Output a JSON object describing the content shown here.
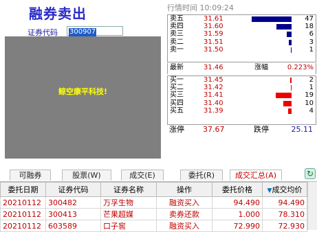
{
  "header": {
    "title": "融券卖出",
    "code_label": "证券代码",
    "code_value": "300907",
    "placeholder_message": "鲸空康平科技!"
  },
  "quote": {
    "time_label": "行情时间",
    "time_value": "10:09:24",
    "sell": [
      {
        "label": "卖五",
        "price": "31.61",
        "volume": "47",
        "vol_num": 47
      },
      {
        "label": "卖四",
        "price": "31.60",
        "volume": "18",
        "vol_num": 18
      },
      {
        "label": "卖三",
        "price": "31.59",
        "volume": "6",
        "vol_num": 6
      },
      {
        "label": "卖二",
        "price": "31.51",
        "volume": "3",
        "vol_num": 3
      },
      {
        "label": "卖一",
        "price": "31.50",
        "volume": "1",
        "vol_num": 1
      }
    ],
    "latest_label": "最新",
    "latest_value": "31.46",
    "change_label": "涨幅",
    "change_value": "0.223%",
    "buy": [
      {
        "label": "买一",
        "price": "31.45",
        "volume": "2",
        "vol_num": 2
      },
      {
        "label": "买二",
        "price": "31.42",
        "volume": "1",
        "vol_num": 1
      },
      {
        "label": "买三",
        "price": "31.41",
        "volume": "19",
        "vol_num": 19
      },
      {
        "label": "买四",
        "price": "31.40",
        "volume": "10",
        "vol_num": 10
      },
      {
        "label": "买五",
        "price": "31.39",
        "volume": "4",
        "vol_num": 4
      }
    ],
    "limit_up_label": "涨停",
    "limit_up_value": "37.67",
    "limit_down_label": "跌停",
    "limit_down_value": "25.11",
    "colors": {
      "sell_bar": "#00008b",
      "buy_bar": "#ee0000"
    }
  },
  "tabs": [
    {
      "label": "可融券",
      "active": false
    },
    {
      "label": "股票(W)",
      "active": false
    },
    {
      "label": "成交(E)",
      "active": false
    },
    {
      "label": "委托(R)",
      "active": false
    },
    {
      "label": "成交汇总(A)",
      "active": true
    }
  ],
  "refresh_icon": "refresh-icon",
  "table": {
    "columns": [
      "委托日期",
      "证券代码",
      "证券名称",
      "操作",
      "委托价格",
      "成交均价"
    ],
    "sorted_column_marker": "▼",
    "rows": [
      [
        "20210112",
        "300482",
        "万孚生物",
        "融资买入",
        "94.490",
        "94.490"
      ],
      [
        "20210112",
        "300413",
        "芒果超媒",
        "卖券还款",
        "1.000",
        "78.310"
      ],
      [
        "20210112",
        "603589",
        "口子窖",
        "融资买入",
        "72.990",
        "72.930"
      ]
    ]
  }
}
